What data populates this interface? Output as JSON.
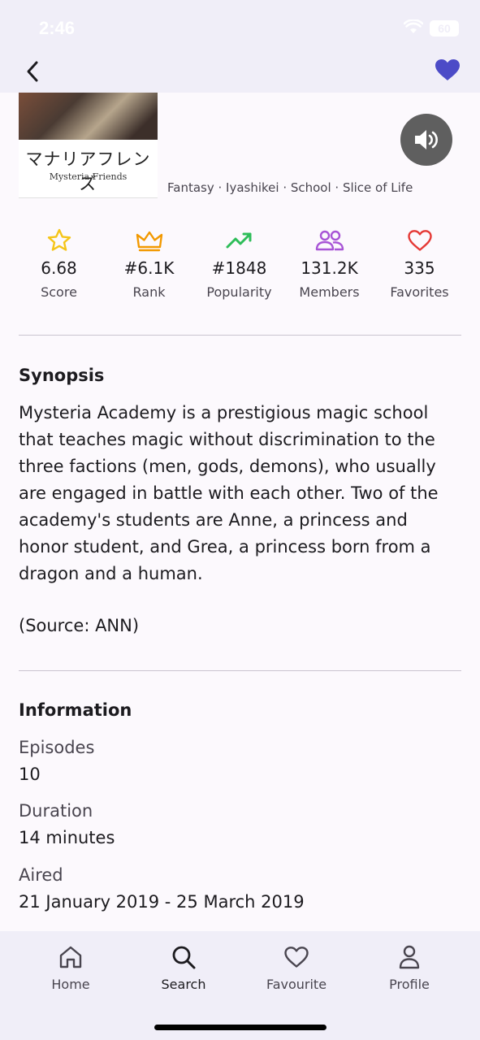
{
  "status": {
    "time": "2:46",
    "battery": "60"
  },
  "header": {
    "back_icon": "chevron-left-icon",
    "favorite_icon": "heart-filled-icon",
    "favorite_color": "#4c4bc7"
  },
  "cover": {
    "title_jp": "マナリアフレンズ",
    "title_en": "Mysteria Friends"
  },
  "genres": "Fantasy · Iyashikei · School · Slice of Life",
  "stats": [
    {
      "icon": "star-icon",
      "color": "#f5c518",
      "value": "6.68",
      "label": "Score"
    },
    {
      "icon": "crown-icon",
      "color": "#f29900",
      "value": "#6.1K",
      "label": "Rank"
    },
    {
      "icon": "trending-up-icon",
      "color": "#2ebd59",
      "value": "#1848",
      "label": "Popularity"
    },
    {
      "icon": "people-icon",
      "color": "#a855d6",
      "value": "131.2K",
      "label": "Members"
    },
    {
      "icon": "heart-icon",
      "color": "#e53935",
      "value": "335",
      "label": "Favorites"
    }
  ],
  "synopsis": {
    "title": "Synopsis",
    "text": "Mysteria Academy is a prestigious magic school that teaches magic without discrimination to the three factions (men, gods, demons), who usually are engaged in battle with each other. Two of the academy's students are Anne, a princess and honor student, and Grea, a princess born from a dragon and a human.",
    "source": "(Source: ANN)"
  },
  "information": {
    "title": "Information",
    "items": [
      {
        "label": "Episodes",
        "value": "10"
      },
      {
        "label": "Duration",
        "value": "14 minutes"
      },
      {
        "label": "Aired",
        "value": "21 January 2019 - 25 March 2019"
      }
    ]
  },
  "nav": [
    {
      "icon": "home-icon",
      "label": "Home"
    },
    {
      "icon": "search-icon",
      "label": "Search"
    },
    {
      "icon": "heart-outline-icon",
      "label": "Favourite"
    },
    {
      "icon": "person-icon",
      "label": "Profile"
    }
  ]
}
